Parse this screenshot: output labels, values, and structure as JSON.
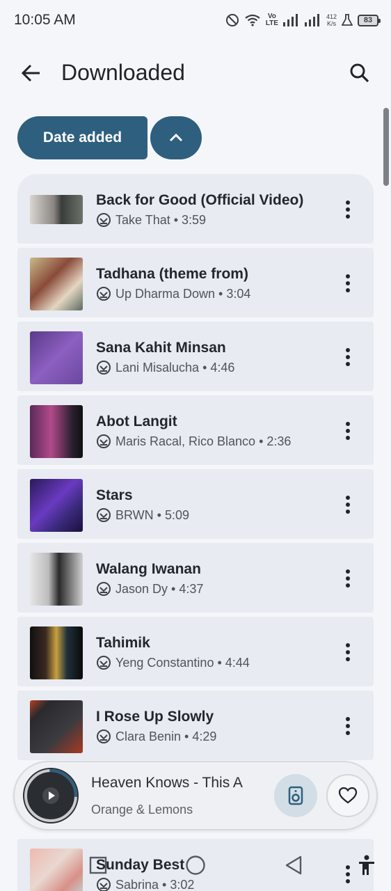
{
  "status": {
    "time": "10:05 AM",
    "network_volte": "Vo\nLTE",
    "net_speed_value": "412",
    "net_speed_unit": "K/s",
    "battery": "83"
  },
  "header": {
    "title": "Downloaded",
    "back_icon": "arrow-back-icon",
    "search_icon": "search-icon"
  },
  "sort": {
    "label": "Date added",
    "order_icon": "chevron-up-icon"
  },
  "songs": [
    {
      "title": "Back for Good (Official Video)",
      "artist": "Take That",
      "duration": "3:59",
      "sub": "Take That • 3:59"
    },
    {
      "title": "Tadhana (theme from)",
      "artist": "Up Dharma Down",
      "duration": "3:04",
      "sub": "Up Dharma Down • 3:04"
    },
    {
      "title": "Sana Kahit Minsan",
      "artist": "Lani Misalucha",
      "duration": "4:46",
      "sub": "Lani Misalucha • 4:46"
    },
    {
      "title": "Abot Langit",
      "artist": "Maris Racal, Rico Blanco",
      "duration": "2:36",
      "sub": "Maris Racal, Rico Blanco • 2:36"
    },
    {
      "title": "Stars",
      "artist": "BRWN",
      "duration": "5:09",
      "sub": "BRWN • 5:09"
    },
    {
      "title": "Walang Iwanan",
      "artist": "Jason Dy",
      "duration": "4:37",
      "sub": "Jason Dy • 4:37"
    },
    {
      "title": "Tahimik",
      "artist": "Yeng Constantino",
      "duration": "4:44",
      "sub": "Yeng Constantino • 4:44"
    },
    {
      "title": "I Rose Up Slowly",
      "artist": "Clara Benin",
      "duration": "4:29",
      "sub": "Clara Benin • 4:29"
    },
    {
      "title": "Sunday Best",
      "artist": "Sabrina",
      "duration": "3:02",
      "sub": "Sabrina • 3:02"
    }
  ],
  "player": {
    "title": "Heaven Knows - This A",
    "artist": "Orange & Lemons",
    "progress": 0.25
  },
  "colors": {
    "accent": "#2e5f7e",
    "row_bg": "#e8ebf1",
    "page_bg": "#f4f6fa"
  }
}
